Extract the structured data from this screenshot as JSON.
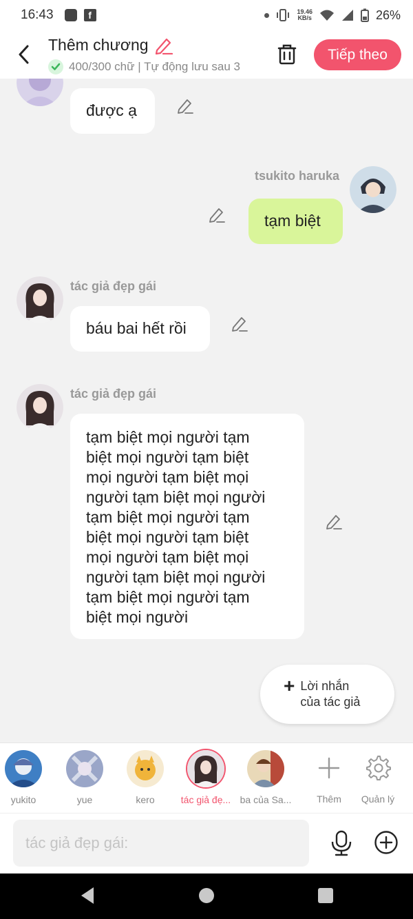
{
  "status_bar": {
    "time": "16:43",
    "net_speed_value": "19.46",
    "net_speed_unit": "KB/s",
    "battery": "26%",
    "icons": [
      "screenshot-icon",
      "facebook-icon",
      "dot-icon",
      "vibrate-icon",
      "wifi-icon",
      "signal-icon",
      "battery-icon"
    ]
  },
  "header": {
    "title": "Thêm chương",
    "subtitle": "400/300 chữ | Tự động lưu sau 3",
    "next_label": "Tiếp theo",
    "accent_color": "#f2546d"
  },
  "messages": [
    {
      "sender": "",
      "text": "được ạ",
      "side": "left"
    },
    {
      "sender": "tsukito haruka",
      "text": "tạm biệt",
      "side": "right",
      "bubble_color": "#d9f59a"
    },
    {
      "sender": "tác giả đẹp gái",
      "text": "báu bai hết rồi",
      "side": "left"
    },
    {
      "sender": "tác giả đẹp gái",
      "side": "left",
      "lines": [
        "tạm biệt mọi người tạm",
        "biệt mọi người tạm biệt",
        "mọi người tạm biệt mọi",
        "người tạm biệt mọi người",
        "tạm biệt mọi người tạm",
        "biệt mọi người tạm biệt",
        "mọi người tạm biệt mọi",
        "người tạm biệt mọi người",
        "tạm biệt mọi người tạm",
        "biệt mọi người"
      ]
    }
  ],
  "note_button": {
    "line1": "Lời nhắn",
    "line2": "của tác giả"
  },
  "characters": [
    {
      "label": "yukito",
      "active": false
    },
    {
      "label": "yue",
      "active": false
    },
    {
      "label": "kero",
      "active": false
    },
    {
      "label": "tác giả đẹ...",
      "active": true
    },
    {
      "label": "ba của Sa...",
      "active": false
    }
  ],
  "tools": {
    "add_label": "Thêm",
    "manage_label": "Quản lý"
  },
  "input": {
    "placeholder": "tác giả đẹp gái:"
  }
}
